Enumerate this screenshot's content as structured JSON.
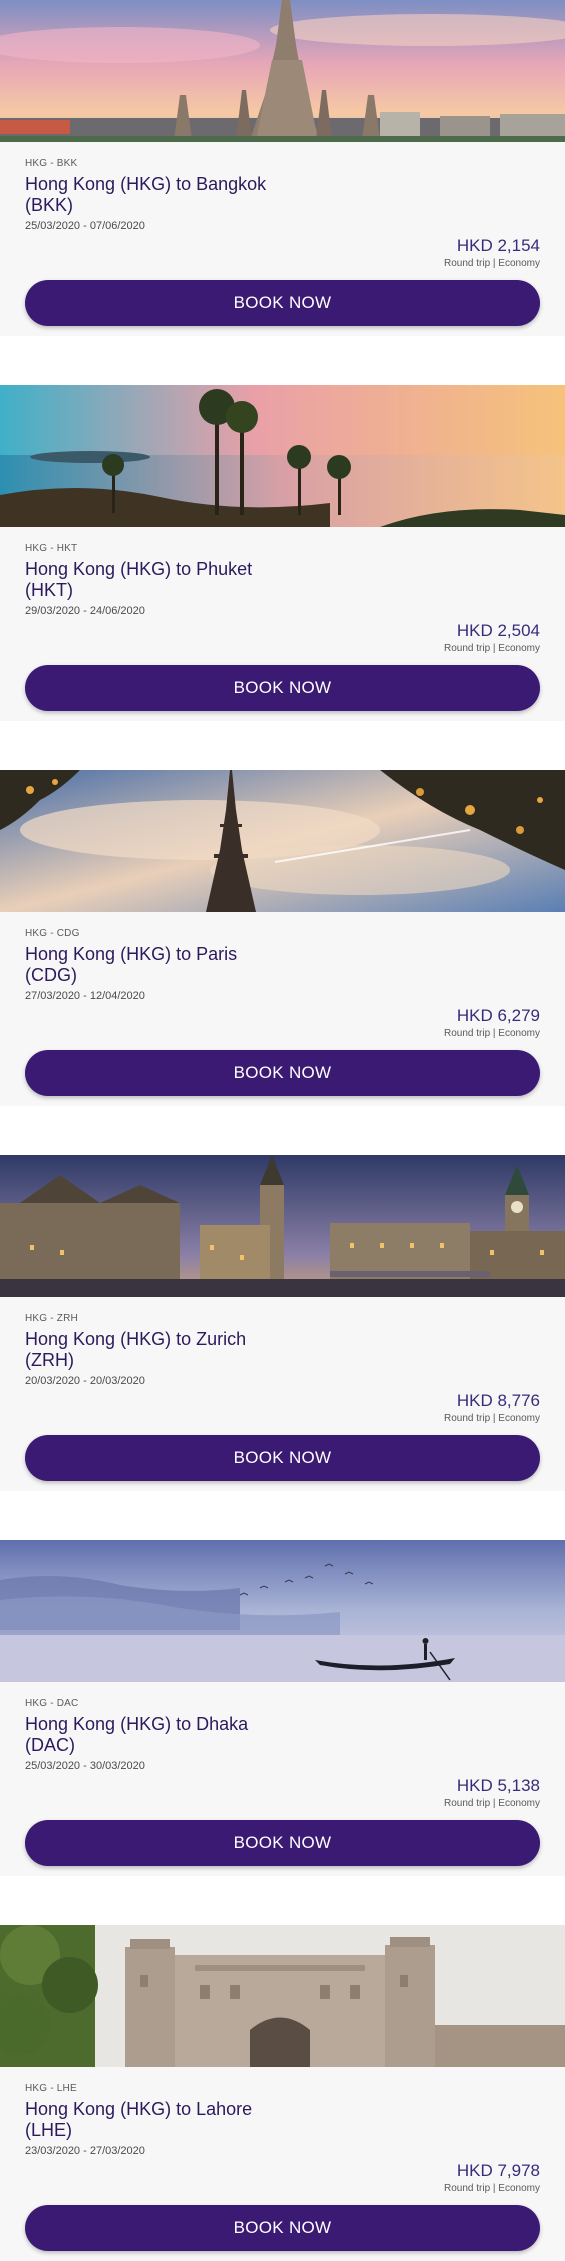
{
  "deals": [
    {
      "route_code": "HKG - BKK",
      "title": "Hong Kong (HKG) to Bangkok (BKK)",
      "dates": "25/03/2020 - 07/06/2020",
      "price": "HKD 2,154",
      "fare_info": "Round trip | Economy",
      "button_label": "BOOK NOW",
      "image": "bangkok-temple-photo"
    },
    {
      "route_code": "HKG - HKT",
      "title": "Hong Kong (HKG) to Phuket (HKT)",
      "dates": "29/03/2020 - 24/06/2020",
      "price": "HKD 2,504",
      "fare_info": "Round trip | Economy",
      "button_label": "BOOK NOW",
      "image": "phuket-palm-sunset-photo"
    },
    {
      "route_code": "HKG - CDG",
      "title": "Hong Kong (HKG) to Paris (CDG)",
      "dates": "27/03/2020 - 12/04/2020",
      "price": "HKD 6,279",
      "fare_info": "Round trip | Economy",
      "button_label": "BOOK NOW",
      "image": "paris-eiffel-tower-photo"
    },
    {
      "route_code": "HKG - ZRH",
      "title": "Hong Kong (HKG) to Zurich (ZRH)",
      "dates": "20/03/2020 - 20/03/2020",
      "price": "HKD 8,776",
      "fare_info": "Round trip | Economy",
      "button_label": "BOOK NOW",
      "image": "zurich-riverside-photo"
    },
    {
      "route_code": "HKG - DAC",
      "title": "Hong Kong (HKG) to Dhaka (DAC)",
      "dates": "25/03/2020 - 30/03/2020",
      "price": "HKD 5,138",
      "fare_info": "Round trip | Economy",
      "button_label": "BOOK NOW",
      "image": "dhaka-river-boat-photo"
    },
    {
      "route_code": "HKG - LHE",
      "title": "Hong Kong (HKG) to Lahore (LHE)",
      "dates": "23/03/2020 - 27/03/2020",
      "price": "HKD 7,978",
      "fare_info": "Round trip | Economy",
      "button_label": "BOOK NOW",
      "image": "lahore-fort-photo"
    }
  ],
  "colors": {
    "card_background": "#f7f7f7",
    "button": "#3a1a73",
    "title_text": "#2d1a5c"
  }
}
